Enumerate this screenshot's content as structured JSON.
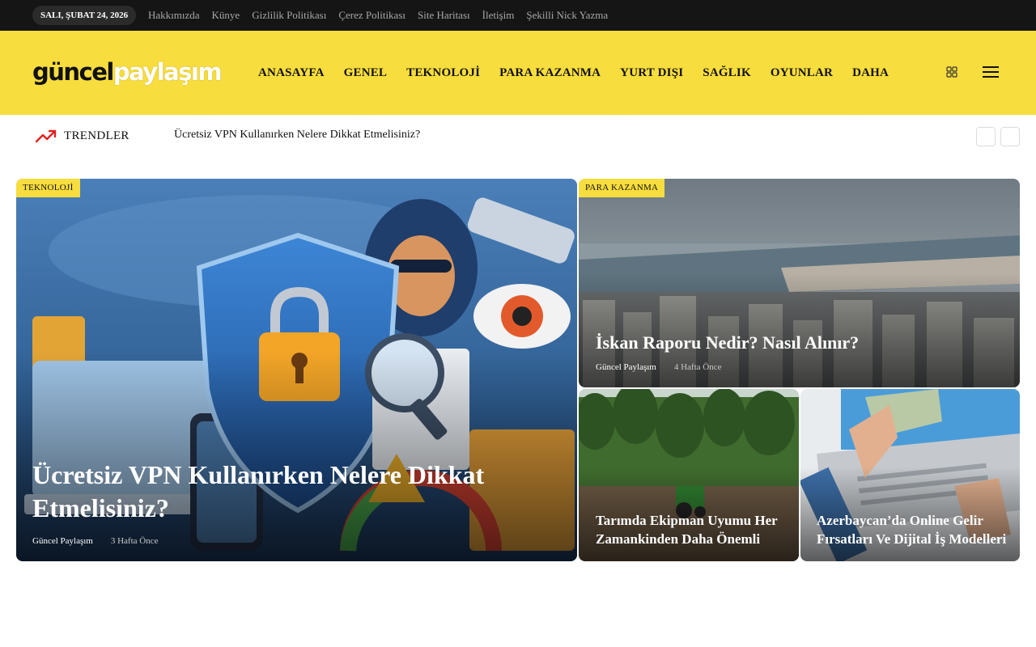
{
  "topbar": {
    "date": "SALI, ŞUBAT 24, 2026",
    "links": [
      "Hakkımızda",
      "Künye",
      "Gizlilik Politikası",
      "Çerez Politikası",
      "Site Haritası",
      "İletişim",
      "Şekilli Nick Yazma"
    ]
  },
  "header": {
    "logo_part1": "güncel",
    "logo_part2": "paylaşım",
    "nav": [
      "ANASAYFA",
      "GENEL",
      "TEKNOLOJİ",
      "PARA KAZANMA",
      "YURT DIŞI",
      "SAĞLIK",
      "OYUNLAR",
      "DAHA"
    ],
    "icons": [
      "grid-icon",
      "hamburger-menu-icon"
    ]
  },
  "trending": {
    "label": "TRENDLER",
    "headline": "Ücretsiz VPN Kullanırken Nelere Dikkat Etmelisiniz?",
    "icon": "trending-up-icon",
    "accent_color": "#e02020"
  },
  "posts": [
    {
      "category": "TEKNOLOJİ",
      "title": "Ücretsiz VPN Kullanırken Nelere Dikkat Etmelisiniz?",
      "author": "Güncel Paylaşım",
      "ago": "3 Hafta Önce"
    },
    {
      "category": "PARA KAZANMA",
      "title": "İskan Raporu Nedir? Nasıl Alınır?",
      "author": "Güncel Paylaşım",
      "ago": "4 Hafta Önce"
    },
    {
      "title": "Tarımda Ekipman Uyumu Her Zamankinden Daha Önemli"
    },
    {
      "title": "Azerbaycan’da Online Gelir Fırsatları Ve Dijital İş Modelleri"
    }
  ],
  "colors": {
    "brand_yellow": "#f7dd3d",
    "topbar_bg": "#151515"
  }
}
